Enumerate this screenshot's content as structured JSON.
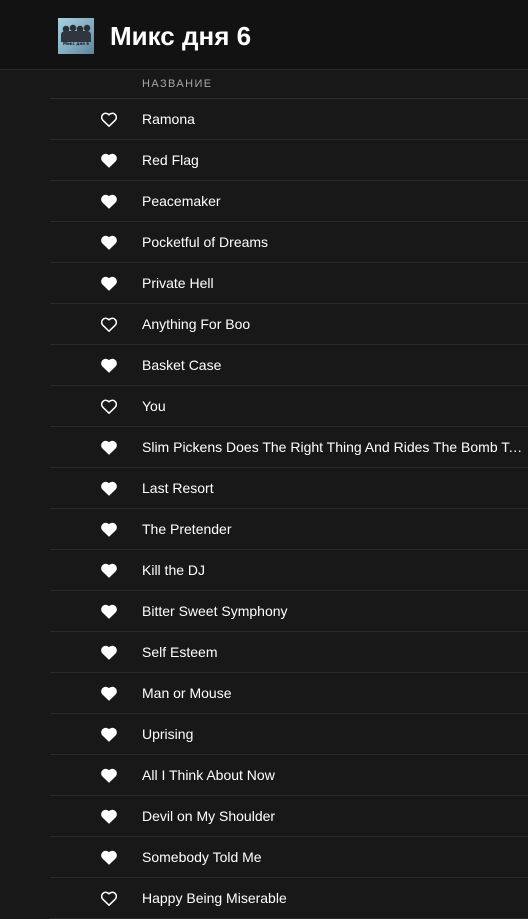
{
  "playlist": {
    "title": "Микс дня 6",
    "cover_label": "Микс дня 6"
  },
  "columns": {
    "title": "НАЗВАНИЕ"
  },
  "colors": {
    "background": "#181818",
    "header_background": "#121212",
    "text": "#ffffff",
    "muted_text": "#a7a7a7"
  },
  "icons": {
    "liked": "heart-filled-icon",
    "not_liked": "heart-outline-icon"
  },
  "tracks": [
    {
      "name": "Ramona",
      "liked": false
    },
    {
      "name": "Red Flag",
      "liked": true
    },
    {
      "name": "Peacemaker",
      "liked": true
    },
    {
      "name": "Pocketful of Dreams",
      "liked": true
    },
    {
      "name": "Private Hell",
      "liked": true
    },
    {
      "name": "Anything For Boo",
      "liked": false
    },
    {
      "name": "Basket Case",
      "liked": true
    },
    {
      "name": "You",
      "liked": false
    },
    {
      "name": "Slim Pickens Does The Right Thing And Rides The Bomb To Hell",
      "liked": true
    },
    {
      "name": "Last Resort",
      "liked": true
    },
    {
      "name": "The Pretender",
      "liked": true
    },
    {
      "name": "Kill the DJ",
      "liked": true
    },
    {
      "name": "Bitter Sweet Symphony",
      "liked": true
    },
    {
      "name": "Self Esteem",
      "liked": true
    },
    {
      "name": "Man or Mouse",
      "liked": true
    },
    {
      "name": "Uprising",
      "liked": true
    },
    {
      "name": "All I Think About Now",
      "liked": true
    },
    {
      "name": "Devil on My Shoulder",
      "liked": true
    },
    {
      "name": "Somebody Told Me",
      "liked": true
    },
    {
      "name": "Happy Being Miserable",
      "liked": false
    }
  ]
}
